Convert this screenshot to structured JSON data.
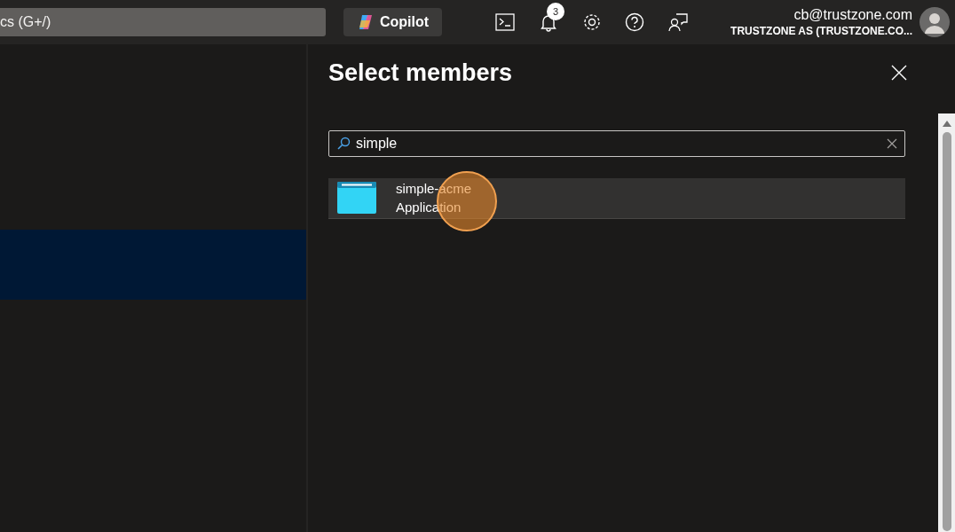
{
  "top_bar": {
    "search": {
      "placeholder": "cs (G+/)"
    },
    "copilot_button": "Copilot",
    "notifications_count": "3",
    "account": {
      "email": "cb@trustzone.com",
      "tenant": "TRUSTZONE AS (TRUSTZONE.CO..."
    }
  },
  "panel": {
    "title": "Select members",
    "search": {
      "value": "simple"
    },
    "results": [
      {
        "name": "simple-acme",
        "type": "Application",
        "selected": false
      }
    ]
  }
}
